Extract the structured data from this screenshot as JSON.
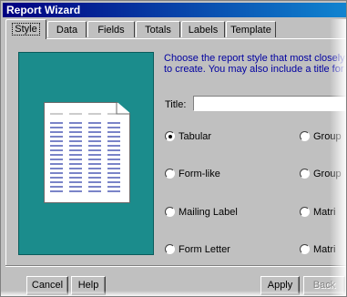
{
  "window": {
    "title": "Report Wizard"
  },
  "tabs": [
    {
      "label": "Style"
    },
    {
      "label": "Data"
    },
    {
      "label": "Fields"
    },
    {
      "label": "Totals"
    },
    {
      "label": "Labels"
    },
    {
      "label": "Template"
    }
  ],
  "description": {
    "line1": "Choose the report style that most closely resemb",
    "line2": "to create. You may also include a title for your re"
  },
  "title_field": {
    "label": "Title:",
    "value": ""
  },
  "styles": [
    {
      "label": "Tabular",
      "checked": true
    },
    {
      "label": "Form-like",
      "checked": false
    },
    {
      "label": "Mailing Label",
      "checked": false
    },
    {
      "label": "Form Letter",
      "checked": false
    },
    {
      "label": "Group",
      "checked": false
    },
    {
      "label": "Group",
      "checked": false
    },
    {
      "label": "Matri",
      "checked": false
    },
    {
      "label": "Matri",
      "checked": false
    }
  ],
  "buttons": {
    "cancel": "Cancel",
    "help": "Help",
    "apply": "Apply",
    "back": "Back"
  },
  "colors": {
    "preview_bg": "#1b8c8c",
    "title_bar": "#000080",
    "description_text": "#0000a0"
  }
}
